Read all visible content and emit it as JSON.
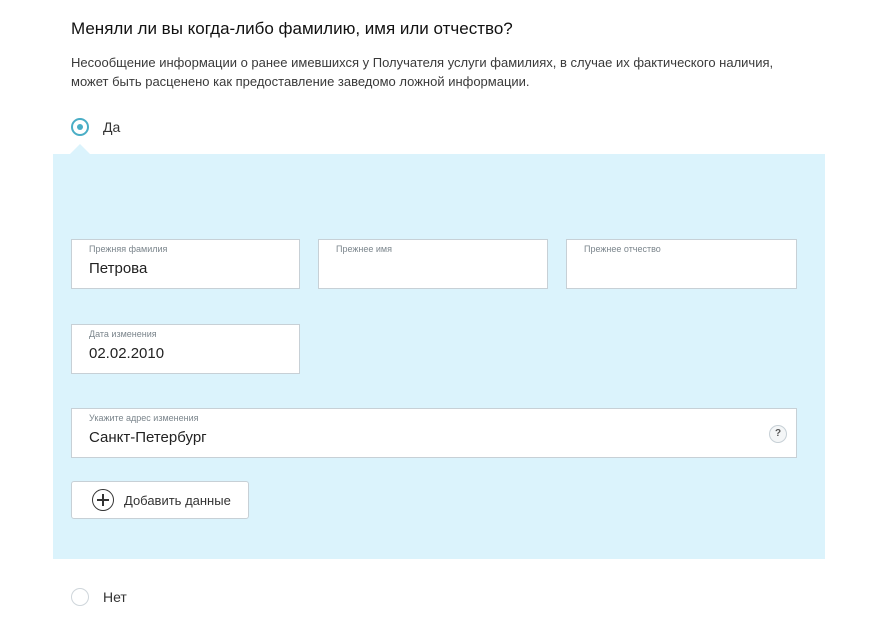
{
  "question": "Меняли ли вы когда-либо фамилию, имя или отчество?",
  "description": "Несообщение информации о ранее имевшихся у Получателя услуги фамилиях, в случае их фактического наличия, может быть расценено как предоставление заведомо ложной информации.",
  "options": {
    "yes": {
      "label": "Да",
      "checked": true
    },
    "no": {
      "label": "Нет",
      "checked": false
    }
  },
  "form": {
    "previous_last_name": {
      "label": "Прежняя фамилия",
      "value": "Петрова"
    },
    "previous_first_name": {
      "label": "Прежнее имя",
      "value": ""
    },
    "previous_middle_name": {
      "label": "Прежнее отчество",
      "value": ""
    },
    "change_date": {
      "label": "Дата изменения",
      "value": "02.02.2010"
    },
    "change_address": {
      "label": "Укажите адрес изменения",
      "value": "Санкт-Петербург",
      "help": "?"
    },
    "add_button_label": "Добавить данные"
  },
  "colors": {
    "accent": "#4aaec6",
    "panel_background": "#dbf3fc"
  },
  "icons": {
    "help": "question-circle-icon",
    "add": "plus-circle-icon"
  }
}
